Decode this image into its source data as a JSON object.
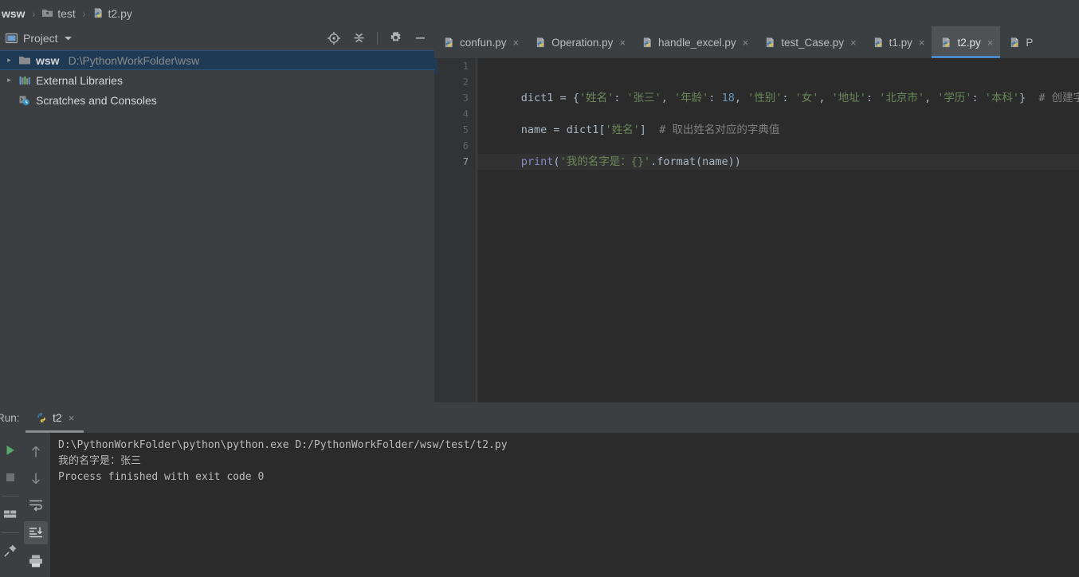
{
  "breadcrumb": {
    "items": [
      {
        "label": "wsw",
        "icon": "",
        "bold": true
      },
      {
        "label": "test",
        "icon": "folder-icon",
        "bold": false
      },
      {
        "label": "t2.py",
        "icon": "python-file-icon",
        "bold": false
      }
    ],
    "separator": "›"
  },
  "project_panel": {
    "title": "Project",
    "dropdown_icon": "chevron-down-icon",
    "panel_icon": "project-panel-icon",
    "toolbar": [
      {
        "name": "locate-icon",
        "label": "Select Opened File"
      },
      {
        "name": "collapse-all-icon",
        "label": "Collapse All"
      },
      {
        "name": "gear-icon",
        "label": "Settings"
      },
      {
        "name": "minimize-icon",
        "label": "Hide"
      }
    ],
    "tree": [
      {
        "label": "wsw",
        "path": "D:\\PythonWorkFolder\\wsw",
        "icon": "folder-icon",
        "arrow": "▸",
        "selected": true,
        "bold": true,
        "indent": 0
      },
      {
        "label": "External Libraries",
        "path": "",
        "icon": "libraries-icon",
        "arrow": "▸",
        "selected": false,
        "bold": false,
        "indent": 0
      },
      {
        "label": "Scratches and Consoles",
        "path": "",
        "icon": "scratches-icon",
        "arrow": "",
        "selected": false,
        "bold": false,
        "indent": 0
      }
    ]
  },
  "editor": {
    "tabs": [
      {
        "label": "confun.py",
        "icon": "python-file-icon",
        "active": false,
        "close": "×"
      },
      {
        "label": "Operation.py",
        "icon": "python-file-icon",
        "active": false,
        "close": "×"
      },
      {
        "label": "handle_excel.py",
        "icon": "python-file-icon",
        "active": false,
        "close": "×"
      },
      {
        "label": "test_Case.py",
        "icon": "python-file-icon",
        "active": false,
        "close": "×"
      },
      {
        "label": "t1.py",
        "icon": "python-file-icon",
        "active": false,
        "close": "×"
      },
      {
        "label": "t2.py",
        "icon": "python-file-icon",
        "active": true,
        "close": "×"
      },
      {
        "label": "P",
        "icon": "python-file-icon",
        "active": false,
        "close": ""
      }
    ],
    "line_numbers": [
      "1",
      "2",
      "3",
      "4",
      "5",
      "6",
      "7"
    ],
    "current_line": 7,
    "lines": [
      {
        "n": 1,
        "tokens": []
      },
      {
        "n": 2,
        "tokens": [
          {
            "t": "dict1 ",
            "c": "tk-op"
          },
          {
            "t": "= ",
            "c": "tk-op"
          },
          {
            "t": "{",
            "c": "tk-brace"
          },
          {
            "t": "'姓名'",
            "c": "tk-str"
          },
          {
            "t": ": ",
            "c": "tk-op"
          },
          {
            "t": "'张三'",
            "c": "tk-str"
          },
          {
            "t": ", ",
            "c": "tk-op"
          },
          {
            "t": "'年龄'",
            "c": "tk-str"
          },
          {
            "t": ": ",
            "c": "tk-op"
          },
          {
            "t": "18",
            "c": "tk-num"
          },
          {
            "t": ", ",
            "c": "tk-op"
          },
          {
            "t": "'性别'",
            "c": "tk-str"
          },
          {
            "t": ": ",
            "c": "tk-op"
          },
          {
            "t": "'女'",
            "c": "tk-str"
          },
          {
            "t": ", ",
            "c": "tk-op"
          },
          {
            "t": "'地址'",
            "c": "tk-str"
          },
          {
            "t": ": ",
            "c": "tk-op"
          },
          {
            "t": "'北京市'",
            "c": "tk-str"
          },
          {
            "t": ", ",
            "c": "tk-op"
          },
          {
            "t": "'学历'",
            "c": "tk-str"
          },
          {
            "t": ": ",
            "c": "tk-op"
          },
          {
            "t": "'本科'",
            "c": "tk-str"
          },
          {
            "t": "}",
            "c": "tk-brace"
          },
          {
            "t": "  # 创建字典",
            "c": "tk-cmt"
          }
        ]
      },
      {
        "n": 3,
        "tokens": []
      },
      {
        "n": 4,
        "tokens": [
          {
            "t": "name ",
            "c": "tk-op"
          },
          {
            "t": "= ",
            "c": "tk-op"
          },
          {
            "t": "dict1[",
            "c": "tk-op"
          },
          {
            "t": "'姓名'",
            "c": "tk-str"
          },
          {
            "t": "]",
            "c": "tk-op"
          },
          {
            "t": "  # 取出姓名对应的字典值",
            "c": "tk-cmt"
          }
        ]
      },
      {
        "n": 5,
        "tokens": []
      },
      {
        "n": 6,
        "tokens": [
          {
            "t": "print",
            "c": "tk-fn"
          },
          {
            "t": "(",
            "c": "tk-op"
          },
          {
            "t": "'我的名字是：{}'",
            "c": "tk-str"
          },
          {
            "t": ".format(name))",
            "c": "tk-op"
          }
        ]
      },
      {
        "n": 7,
        "tokens": []
      }
    ]
  },
  "run_panel": {
    "label": "Run:",
    "tab": {
      "label": "t2",
      "icon": "python-file-icon",
      "close": "×"
    },
    "left_toolbar": [
      {
        "name": "run-icon",
        "label": "Rerun",
        "active": false
      },
      {
        "name": "stop-icon",
        "label": "Stop",
        "active": false
      },
      {
        "name": "layout-icon",
        "label": "Layout",
        "active": false
      },
      {
        "name": "pin-icon",
        "label": "Pin Tab",
        "active": false
      }
    ],
    "console_toolbar": [
      {
        "name": "arrow-up-icon",
        "label": "Up the Stack Trace",
        "active": false
      },
      {
        "name": "arrow-down-icon",
        "label": "Down the Stack Trace",
        "active": false
      },
      {
        "name": "soft-wrap-icon",
        "label": "Soft-Wrap",
        "active": false
      },
      {
        "name": "scroll-to-end-icon",
        "label": "Scroll to End",
        "active": true
      },
      {
        "name": "print-icon",
        "label": "Print",
        "active": false
      }
    ],
    "console_lines": [
      "D:\\PythonWorkFolder\\python\\python.exe D:/PythonWorkFolder/wsw/test/t2.py",
      "我的名字是：张三",
      "",
      "Process finished with exit code 0"
    ]
  },
  "colors": {
    "panel_bg": "#3c3f41",
    "editor_bg": "#2b2b2b",
    "gutter_bg": "#313335",
    "selection_blue": "#1f3a55",
    "tab_accent": "#4a88c7",
    "string_green": "#6a8759",
    "number_blue": "#6897bb",
    "comment_gray": "#808080",
    "function_purple": "#8888c6",
    "text_gray": "#a9b7c6"
  }
}
